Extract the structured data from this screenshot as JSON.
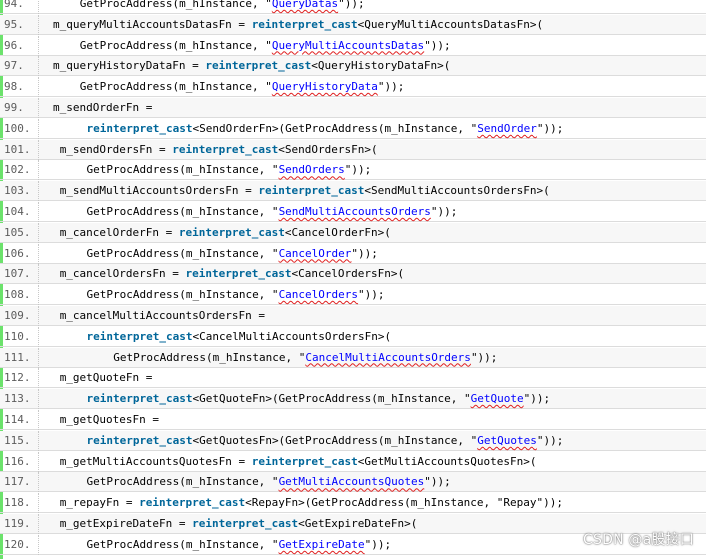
{
  "code_lines": [
    {
      "num": "94.",
      "indent": 4,
      "segments": [
        [
          "p",
          "GetProcAddress(m_hInstance, \""
        ],
        [
          "s",
          "QueryDatas"
        ],
        [
          "p",
          "\"));"
        ]
      ]
    },
    {
      "num": "95.",
      "indent": 0,
      "segments": [
        [
          "p",
          "m_queryMultiAccountsDatasFn = "
        ],
        [
          "k",
          "reinterpret_cast"
        ],
        [
          "p",
          "<QueryMultiAccountsDatasFn>("
        ]
      ]
    },
    {
      "num": "96.",
      "indent": 4,
      "segments": [
        [
          "p",
          "GetProcAddress(m_hInstance, \""
        ],
        [
          "s",
          "QueryMultiAccountsDatas"
        ],
        [
          "p",
          "\"));"
        ]
      ]
    },
    {
      "num": "97.",
      "indent": 0,
      "segments": [
        [
          "p",
          "m_queryHistoryDataFn = "
        ],
        [
          "k",
          "reinterpret_cast"
        ],
        [
          "p",
          "<QueryHistoryDataFn>("
        ]
      ]
    },
    {
      "num": "98.",
      "indent": 4,
      "segments": [
        [
          "p",
          "GetProcAddress(m_hInstance, \""
        ],
        [
          "s",
          "QueryHistoryData"
        ],
        [
          "p",
          "\"));"
        ]
      ]
    },
    {
      "num": "99.",
      "indent": 0,
      "segments": [
        [
          "p",
          "m_sendOrderFn ="
        ]
      ]
    },
    {
      "num": "100.",
      "indent": 5,
      "segments": [
        [
          "k",
          "reinterpret_cast"
        ],
        [
          "p",
          "<SendOrderFn>(GetProcAddress(m_hInstance, \""
        ],
        [
          "s",
          "SendOrder"
        ],
        [
          "p",
          "\"));"
        ]
      ]
    },
    {
      "num": "101.",
      "indent": 1,
      "segments": [
        [
          "p",
          "m_sendOrdersFn = "
        ],
        [
          "k",
          "reinterpret_cast"
        ],
        [
          "p",
          "<SendOrdersFn>("
        ]
      ]
    },
    {
      "num": "102.",
      "indent": 5,
      "segments": [
        [
          "p",
          "GetProcAddress(m_hInstance, \""
        ],
        [
          "s",
          "SendOrders"
        ],
        [
          "p",
          "\"));"
        ]
      ]
    },
    {
      "num": "103.",
      "indent": 1,
      "segments": [
        [
          "p",
          "m_sendMultiAccountsOrdersFn = "
        ],
        [
          "k",
          "reinterpret_cast"
        ],
        [
          "p",
          "<SendMultiAccountsOrdersFn>("
        ]
      ]
    },
    {
      "num": "104.",
      "indent": 5,
      "segments": [
        [
          "p",
          "GetProcAddress(m_hInstance, \""
        ],
        [
          "s",
          "SendMultiAccountsOrders"
        ],
        [
          "p",
          "\"));"
        ]
      ]
    },
    {
      "num": "105.",
      "indent": 1,
      "segments": [
        [
          "p",
          "m_cancelOrderFn = "
        ],
        [
          "k",
          "reinterpret_cast"
        ],
        [
          "p",
          "<CancelOrderFn>("
        ]
      ]
    },
    {
      "num": "106.",
      "indent": 5,
      "segments": [
        [
          "p",
          "GetProcAddress(m_hInstance, \""
        ],
        [
          "s",
          "CancelOrder"
        ],
        [
          "p",
          "\"));"
        ]
      ]
    },
    {
      "num": "107.",
      "indent": 1,
      "segments": [
        [
          "p",
          "m_cancelOrdersFn = "
        ],
        [
          "k",
          "reinterpret_cast"
        ],
        [
          "p",
          "<CancelOrdersFn>("
        ]
      ]
    },
    {
      "num": "108.",
      "indent": 5,
      "segments": [
        [
          "p",
          "GetProcAddress(m_hInstance, \""
        ],
        [
          "s",
          "CancelOrders"
        ],
        [
          "p",
          "\"));"
        ]
      ]
    },
    {
      "num": "109.",
      "indent": 1,
      "segments": [
        [
          "p",
          "m_cancelMultiAccountsOrdersFn ="
        ]
      ]
    },
    {
      "num": "110.",
      "indent": 5,
      "segments": [
        [
          "k",
          "reinterpret_cast"
        ],
        [
          "p",
          "<CancelMultiAccountsOrdersFn>("
        ]
      ]
    },
    {
      "num": "111.",
      "indent": 9,
      "segments": [
        [
          "p",
          "GetProcAddress(m_hInstance, \""
        ],
        [
          "s",
          "CancelMultiAccountsOrders"
        ],
        [
          "p",
          "\"));"
        ]
      ]
    },
    {
      "num": "112.",
      "indent": 1,
      "segments": [
        [
          "p",
          "m_getQuoteFn ="
        ]
      ]
    },
    {
      "num": "113.",
      "indent": 5,
      "segments": [
        [
          "k",
          "reinterpret_cast"
        ],
        [
          "p",
          "<GetQuoteFn>(GetProcAddress(m_hInstance, \""
        ],
        [
          "s",
          "GetQuote"
        ],
        [
          "p",
          "\"));"
        ]
      ]
    },
    {
      "num": "114.",
      "indent": 1,
      "segments": [
        [
          "p",
          "m_getQuotesFn ="
        ]
      ]
    },
    {
      "num": "115.",
      "indent": 5,
      "segments": [
        [
          "k",
          "reinterpret_cast"
        ],
        [
          "p",
          "<GetQuotesFn>(GetProcAddress(m_hInstance, \""
        ],
        [
          "s",
          "GetQuotes"
        ],
        [
          "p",
          "\"));"
        ]
      ]
    },
    {
      "num": "116.",
      "indent": 1,
      "segments": [
        [
          "p",
          "m_getMultiAccountsQuotesFn = "
        ],
        [
          "k",
          "reinterpret_cast"
        ],
        [
          "p",
          "<GetMultiAccountsQuotesFn>("
        ]
      ]
    },
    {
      "num": "117.",
      "indent": 5,
      "segments": [
        [
          "p",
          "GetProcAddress(m_hInstance, \""
        ],
        [
          "s",
          "GetMultiAccountsQuotes"
        ],
        [
          "p",
          "\"));"
        ]
      ]
    },
    {
      "num": "118.",
      "indent": 1,
      "segments": [
        [
          "p",
          "m_repayFn = "
        ],
        [
          "k",
          "reinterpret_cast"
        ],
        [
          "p",
          "<RepayFn>(GetProcAddress(m_hInstance, \"Repay\"));"
        ]
      ]
    },
    {
      "num": "119.",
      "indent": 1,
      "segments": [
        [
          "p",
          "m_getExpireDateFn = "
        ],
        [
          "k",
          "reinterpret_cast"
        ],
        [
          "p",
          "<GetExpireDateFn>("
        ]
      ]
    },
    {
      "num": "120.",
      "indent": 5,
      "segments": [
        [
          "p",
          "GetProcAddress(m_hInstance, \""
        ],
        [
          "s",
          "GetExpireDate"
        ],
        [
          "p",
          "\"));"
        ]
      ]
    }
  ],
  "watermark": "CSDN @a股接口",
  "colors": {
    "keyword": "#006699",
    "string": "#0000ff",
    "line_number": "#5c5c5c",
    "gutter_accent": "#6ce26c"
  }
}
